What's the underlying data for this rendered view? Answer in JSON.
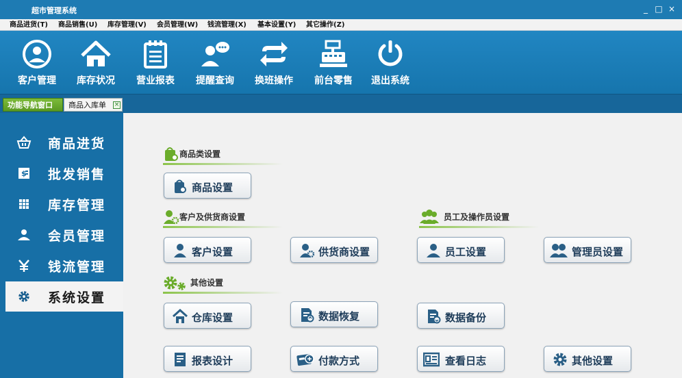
{
  "window": {
    "title": "超市管理系统",
    "controls": [
      "_",
      "□",
      "×"
    ]
  },
  "menu": [
    "商品进货(T)",
    "商品销售(U)",
    "库存管理(V)",
    "会员管理(W)",
    "钱流管理(X)",
    "基本设置(Y)",
    "其它操作(Z)"
  ],
  "toolbar": [
    {
      "label": "客户管理",
      "icon": "user-circle-icon"
    },
    {
      "label": "库存状况",
      "icon": "house-icon"
    },
    {
      "label": "营业报表",
      "icon": "notepad-icon"
    },
    {
      "label": "提醒查询",
      "icon": "user-chat-icon"
    },
    {
      "label": "换班操作",
      "icon": "swap-arrows-icon"
    },
    {
      "label": "前台零售",
      "icon": "cash-register-icon"
    },
    {
      "label": "退出系统",
      "icon": "power-icon"
    }
  ],
  "tabs": {
    "active": "功能导航窗口",
    "second": "商品入库单",
    "close": "×"
  },
  "sidebar": [
    {
      "label": "商品进货",
      "icon": "basket-icon"
    },
    {
      "label": "批发销售",
      "icon": "dollar-card-icon"
    },
    {
      "label": "库存管理",
      "icon": "grid-icon"
    },
    {
      "label": "会员管理",
      "icon": "person-icon"
    },
    {
      "label": "钱流管理",
      "icon": "yen-icon"
    },
    {
      "label": "系统设置",
      "icon": "gear-icon",
      "active": true
    }
  ],
  "sections": {
    "goods": "商品类设置",
    "customer": "客户及供货商设置",
    "staff": "员工及操作员设置",
    "other": "其他设置"
  },
  "buttons": {
    "goods_setting": "商品设置",
    "customer_setting": "客户设置",
    "supplier_setting": "供货商设置",
    "employee_setting": "员工设置",
    "admin_setting": "管理员设置",
    "warehouse_setting": "仓库设置",
    "data_restore": "数据恢复",
    "data_backup": "数据备份",
    "report_design": "报表设计",
    "payment_method": "付款方式",
    "view_log": "查看日志",
    "other_setting": "其他设置"
  },
  "colors": {
    "primary_blue": "#1e7bb3",
    "accent_green": "#6aac2a",
    "button_text": "#1f3d5a"
  }
}
